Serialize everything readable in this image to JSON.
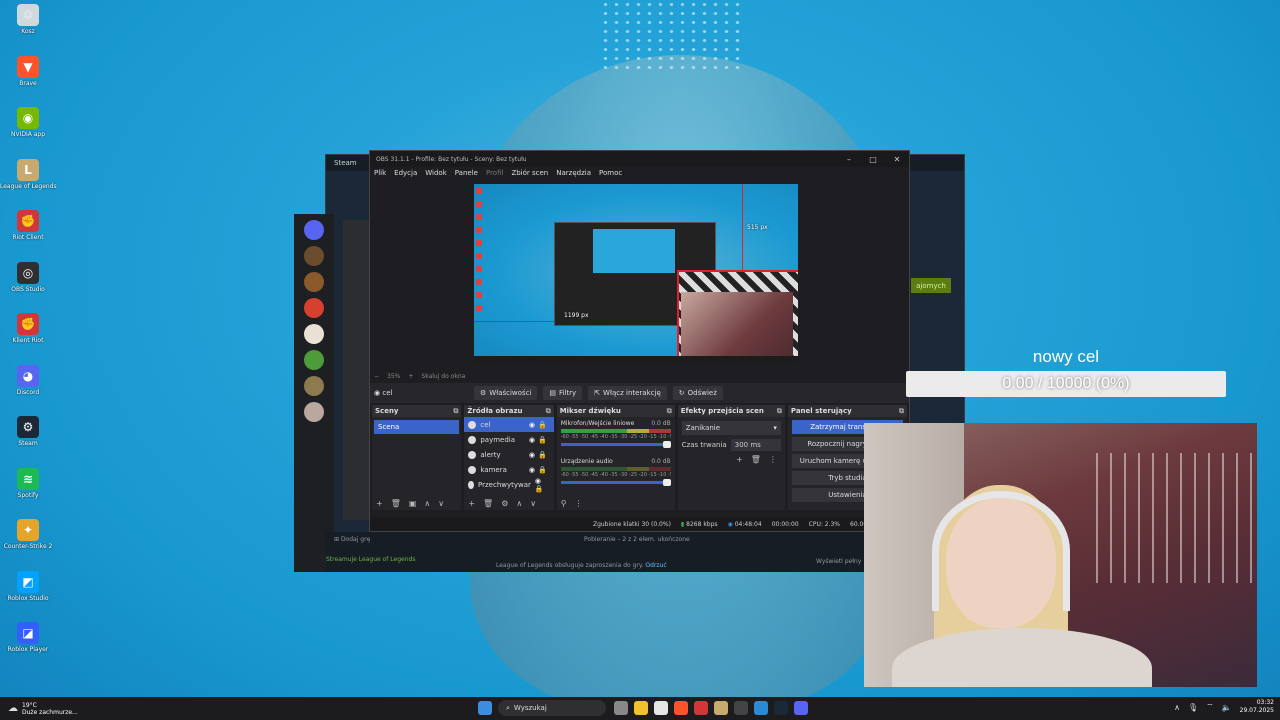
{
  "desktop": {
    "icons": [
      {
        "label": "Kosz",
        "icon": "recycle-bin-icon",
        "color": "#cfd8dc",
        "glyph": "♲"
      },
      {
        "label": "Brave",
        "icon": "brave-icon",
        "color": "#fb542b",
        "glyph": "▼"
      },
      {
        "label": "NVIDIA app",
        "icon": "nvidia-icon",
        "color": "#76b900",
        "glyph": "◉"
      },
      {
        "label": "League of Legends",
        "icon": "league-icon",
        "color": "#c8aa6e",
        "glyph": "L"
      },
      {
        "label": "Riot Client",
        "icon": "riot-icon",
        "color": "#d13639",
        "glyph": "✊"
      },
      {
        "label": "OBS Studio",
        "icon": "obs-icon",
        "color": "#302e31",
        "glyph": "◎"
      },
      {
        "label": "Klient Riot",
        "icon": "riot-icon",
        "color": "#d13639",
        "glyph": "✊"
      },
      {
        "label": "Discord",
        "icon": "discord-icon",
        "color": "#5865f2",
        "glyph": "◕"
      },
      {
        "label": "Steam",
        "icon": "steam-icon",
        "color": "#1b2838",
        "glyph": "⚙"
      },
      {
        "label": "Spotify",
        "icon": "spotify-icon",
        "color": "#1db954",
        "glyph": "≋"
      },
      {
        "label": "Counter-Strike 2",
        "icon": "cs2-icon",
        "color": "#e5a42a",
        "glyph": "✦"
      },
      {
        "label": "Roblox Studio",
        "icon": "roblox-studio-icon",
        "color": "#00a2ff",
        "glyph": "◩"
      },
      {
        "label": "Roblox Player",
        "icon": "roblox-player-icon",
        "color": "#335fff",
        "glyph": "◪"
      }
    ]
  },
  "steam": {
    "title": "Steam",
    "friend_button": "ajomych",
    "bottom_add_game": "Dodaj grę",
    "bottom_download": "Pobieranie – 2 z 2 elem. ukończone",
    "bottom_status": "League of Legends obsługuje zaproszenia do gry.",
    "bottom_dismiss": "Odrzuć",
    "bottom_friends": "Wyświetl pełny",
    "streaming": "Streamuje League of Legends"
  },
  "obs": {
    "title": "OBS 31.1.1 - Profile: Bez tytułu - Sceny: Bez tytułu",
    "menu": [
      "Plik",
      "Edycja",
      "Widok",
      "Panele",
      "Profil",
      "Zbiór scen",
      "Narzędzia",
      "Pomoc"
    ],
    "dim_menu": "Profil",
    "preview": {
      "px_top": "515 px",
      "px_left": "1199 px",
      "zoom": "35%",
      "fit": "Skaluj do okna"
    },
    "selected_source": "cel",
    "source_buttons": [
      "Właściwości",
      "Filtry",
      "Włącz interakcję",
      "Odśwież"
    ],
    "docks": {
      "scenes": {
        "title": "Sceny",
        "items": [
          "Scena"
        ]
      },
      "sources": {
        "title": "Źródła obrazu",
        "items": [
          "cel",
          "paymedia",
          "alerty",
          "kamera",
          "Przechwytywar"
        ]
      },
      "mixer": {
        "title": "Mikser dźwięku",
        "channels": [
          {
            "name": "Mikrofon/Wejście liniowe",
            "db": "0.0 dB"
          },
          {
            "name": "Urządzenie audio",
            "db": "0.0 dB"
          }
        ],
        "ticks": "-60 -55 -50 -45 -40 -35 -30 -25 -20 -15 -10 -5 0"
      },
      "transitions": {
        "title": "Efekty przejścia scen",
        "selected": "Zanikanie",
        "duration_label": "Czas trwania",
        "duration_value": "300 ms"
      },
      "controls": {
        "title": "Panel sterujący",
        "buttons": [
          "Zatrzymaj transmisję",
          "Rozpocznij nagrywanie",
          "Uruchom kamerę wirtualną",
          "Tryb studia",
          "Ustawienia"
        ]
      }
    },
    "status": {
      "dropped": "Zgubione klatki 30 (0.0%)",
      "kbps": "8268 kbps",
      "live_time": "04:48:04",
      "rec_time": "00:00:00",
      "cpu": "CPU: 2.3%",
      "fps": "60.00 / 60.00 FPS"
    }
  },
  "goal": {
    "title": "nowy cel",
    "text": "0.00 / 10000 (0%)",
    "progress": 0
  },
  "taskbar": {
    "weather_temp": "19°C",
    "weather_desc": "Duże zachmurze...",
    "search_placeholder": "Wyszukaj",
    "time": "03:32",
    "date": "29.07.2025"
  }
}
